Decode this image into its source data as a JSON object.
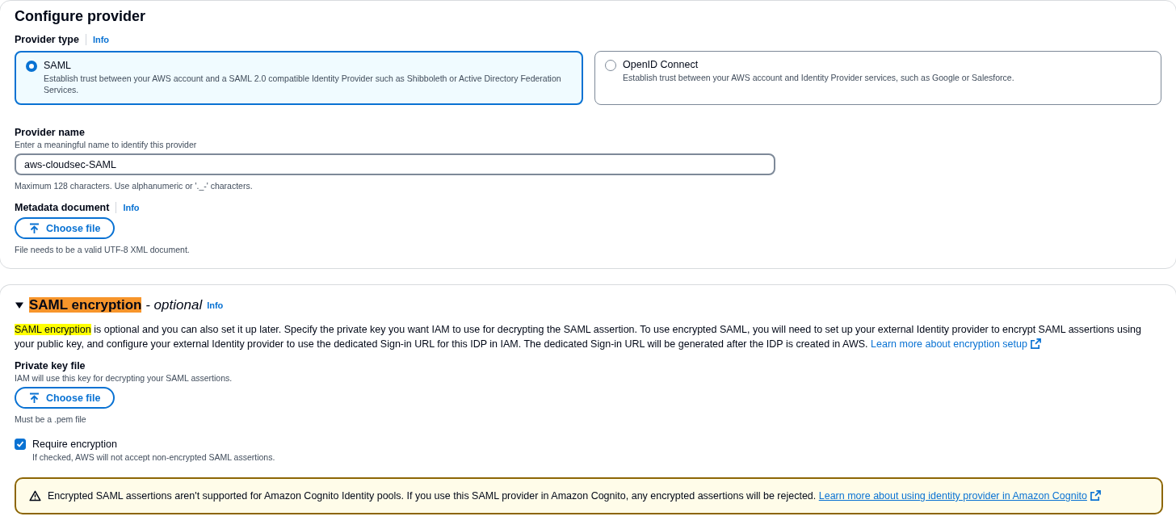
{
  "configure_provider": {
    "title": "Configure provider",
    "provider_type": {
      "label": "Provider type",
      "info": "Info",
      "options": [
        {
          "title": "SAML",
          "description": "Establish trust between your AWS account and a SAML 2.0 compatible Identity Provider such as Shibboleth or Active Directory Federation Services.",
          "selected": true
        },
        {
          "title": "OpenID Connect",
          "description": "Establish trust between your AWS account and Identity Provider services, such as Google or Salesforce.",
          "selected": false
        }
      ]
    },
    "provider_name": {
      "label": "Provider name",
      "description": "Enter a meaningful name to identify this provider",
      "value": "aws-cloudsec-SAML",
      "constraint": "Maximum 128 characters. Use alphanumeric or '._-' characters."
    },
    "metadata_document": {
      "label": "Metadata document",
      "info": "Info",
      "button": "Choose file",
      "constraint": "File needs to be a valid UTF-8 XML document."
    }
  },
  "saml_encryption": {
    "expanded": true,
    "title": "SAML encryption",
    "title_highlighted": true,
    "suffix": "- optional",
    "info": "Info",
    "lead": "SAML encryption",
    "lead_highlighted": true,
    "text": " is optional and you can also set it up later. Specify the private key you want IAM to use for decrypting the SAML assertion. To use encrypted SAML, you will need to set up your external Identity provider to encrypt SAML assertions using your public key, and configure your external Identity provider to use the dedicated Sign-in URL for this IDP in IAM. The dedicated Sign-in URL will be generated after the IDP is created in AWS.",
    "link": "Learn more about encryption setup",
    "private_key": {
      "label": "Private key file",
      "description": "IAM will use this key for decrypting your SAML assertions.",
      "button": "Choose file",
      "constraint": "Must be a .pem file"
    },
    "require_encryption": {
      "label": "Require encryption",
      "description": "If checked, AWS will not accept non-encrypted SAML assertions.",
      "checked": true
    },
    "alert": {
      "text": "Encrypted SAML assertions aren't supported for Amazon Cognito Identity pools. If you use this SAML provider in Amazon Cognito, any encrypted assertions will be rejected.",
      "link": "Learn more about using identity provider in Amazon Cognito"
    }
  }
}
